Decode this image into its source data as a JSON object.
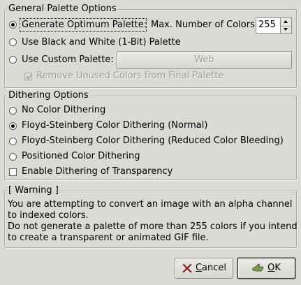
{
  "general": {
    "title": "General Palette Options",
    "optimum_label": "Generate Optimum Palette:",
    "max_colors_label": "Max. Number of Colors:",
    "max_colors_value": "255",
    "bw_label": "Use Black and White (1-Bit) Palette",
    "custom_label": "Use Custom Palette:",
    "custom_palette_button": "Web",
    "remove_unused_label": "Remove Unused Colors from Final Palette",
    "selected": "optimum"
  },
  "dithering": {
    "title": "Dithering Options",
    "options": [
      {
        "label": "No Color Dithering",
        "checked": false
      },
      {
        "label": "Floyd-Steinberg Color Dithering (Normal)",
        "checked": true
      },
      {
        "label": "Floyd-Steinberg Color Dithering (Reduced Color Bleeding)",
        "checked": false
      },
      {
        "label": "Positioned Color Dithering",
        "checked": false
      }
    ],
    "transparency_label": "Enable Dithering of Transparency"
  },
  "warning": {
    "title": "[ Warning ]",
    "lines": [
      "You are attempting to convert an image with an alpha channel",
      "to indexed colors.",
      "Do not generate a palette of more than 255 colors if you intend",
      "to create a transparent or animated GIF file."
    ]
  },
  "buttons": {
    "cancel_label_first": "C",
    "cancel_label_rest": "ancel",
    "ok_label_first": "O",
    "ok_label_rest": "K"
  },
  "icons": {
    "cancel": "x-mark-icon",
    "ok": "hand-ok-icon",
    "cancel_color": "#b3141c"
  }
}
